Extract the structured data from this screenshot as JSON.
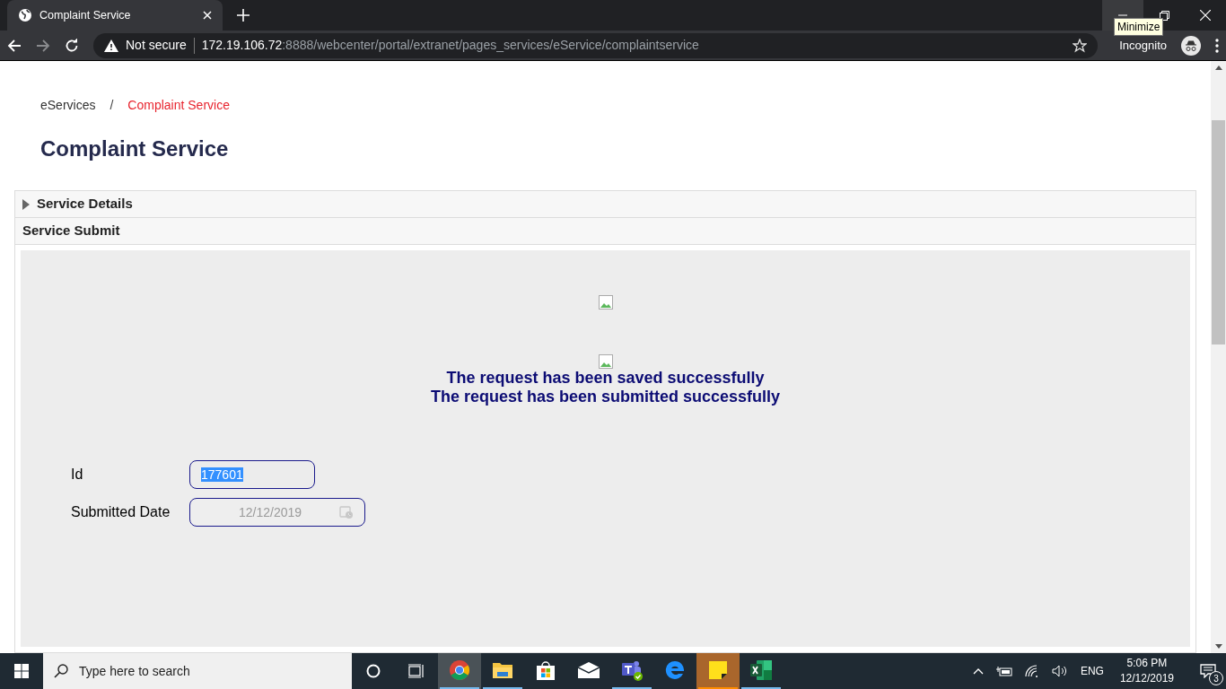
{
  "browser": {
    "tab_title": "Complaint Service",
    "not_secure": "Not secure",
    "url_host": "172.19.106.72",
    "url_rest": ":8888/webcenter/portal/extranet/pages_services/eService/complaintservice",
    "profile": "Incognito",
    "tooltip": "Minimize"
  },
  "breadcrumb": [
    {
      "label": "eServices",
      "current": false
    },
    {
      "label": "Complaint Service",
      "current": true
    }
  ],
  "breadcrumb_separator": "/",
  "heading": "Complaint Service",
  "sections": [
    {
      "kind": "collapsible",
      "title": "Service Details",
      "expanded": false
    },
    {
      "kind": "header",
      "title": "Service Submit"
    }
  ],
  "messages": [
    "The request has been saved successfully",
    "The request has been submitted successfully"
  ],
  "fields": [
    {
      "kind": "text",
      "label": "Id",
      "value": "177601",
      "value_selected": true,
      "disabled": false
    },
    {
      "kind": "date",
      "label": "Submitted Date",
      "value": "12/12/2019",
      "value_selected": false,
      "disabled": true
    }
  ],
  "taskbar": {
    "search_placeholder": "Type here to search",
    "apps": [
      {
        "kind": "chrome",
        "running": true,
        "selected": true,
        "attention": false
      },
      {
        "kind": "folder",
        "running": true,
        "selected": false,
        "attention": false
      },
      {
        "kind": "store",
        "running": false,
        "selected": false,
        "attention": false
      },
      {
        "kind": "mail",
        "running": false,
        "selected": false,
        "attention": false
      },
      {
        "kind": "teams",
        "running": true,
        "selected": false,
        "attention": false
      },
      {
        "kind": "edge",
        "running": false,
        "selected": false,
        "attention": false
      },
      {
        "kind": "notes",
        "running": true,
        "selected": false,
        "attention": true
      },
      {
        "kind": "excel",
        "running": true,
        "selected": false,
        "attention": false
      }
    ],
    "language": "ENG",
    "time": "5:06 PM",
    "date": "12/12/2019",
    "notifications": "3"
  }
}
